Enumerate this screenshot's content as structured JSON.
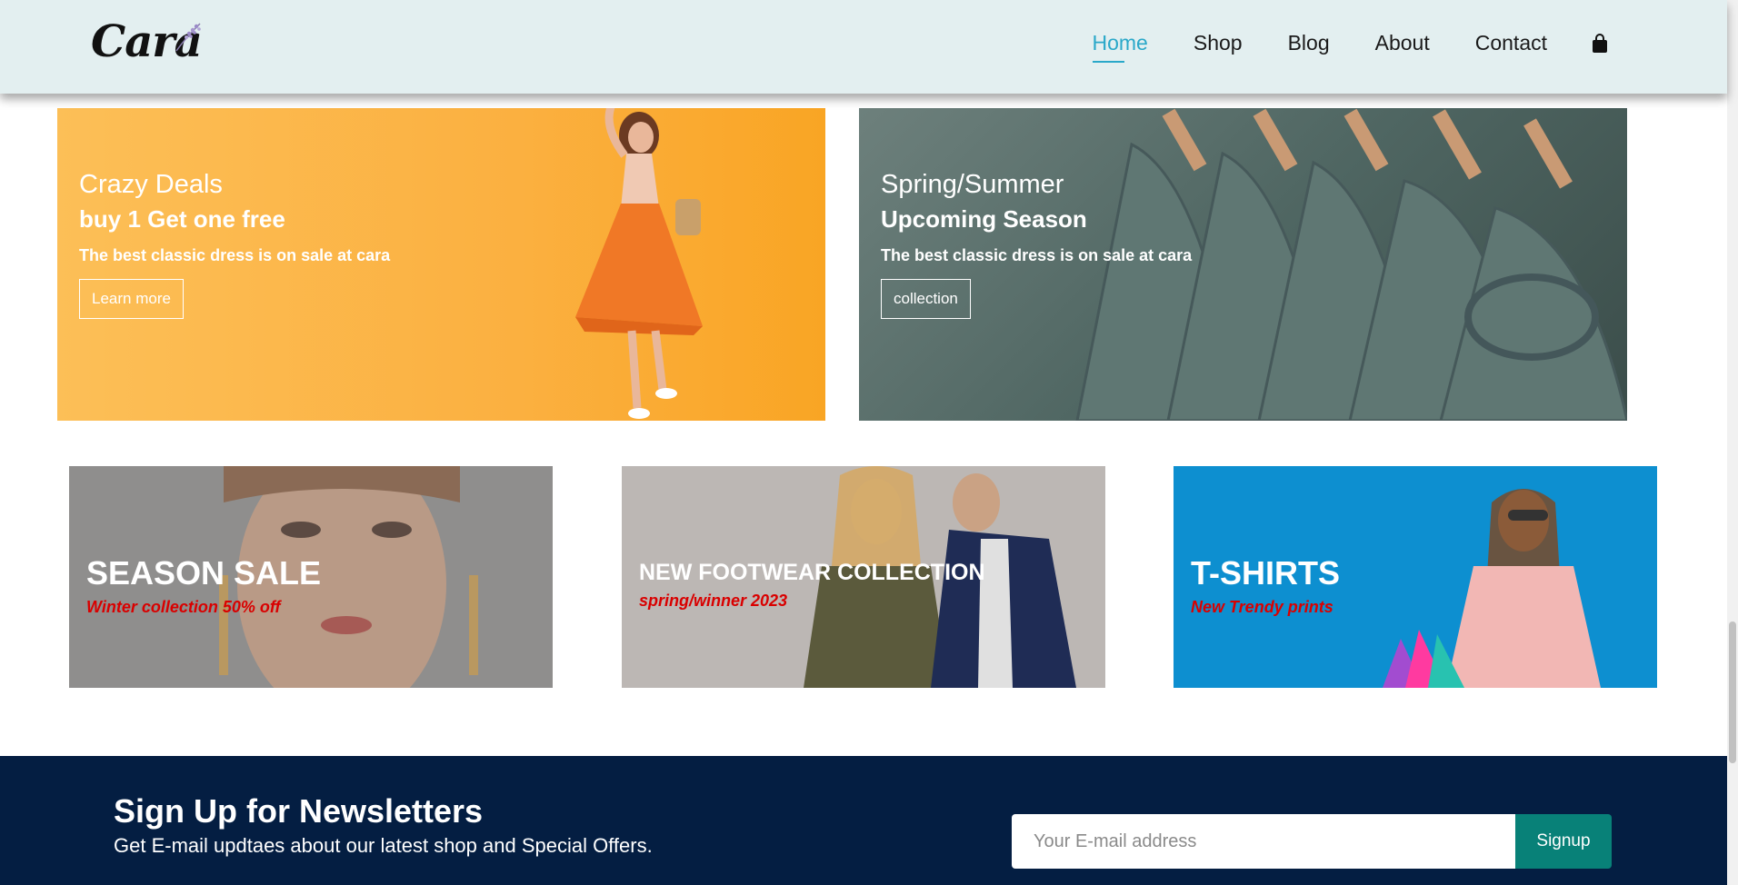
{
  "header": {
    "logo": "Cara",
    "nav": [
      "Home",
      "Shop",
      "Blog",
      "About",
      "Contact"
    ],
    "active": "Home"
  },
  "banners_big": [
    {
      "h4": "Crazy Deals",
      "h2": "buy 1 Get one free",
      "sub": "The best classic dress is on sale at cara",
      "button": "Learn more"
    },
    {
      "h4": "Spring/Summer",
      "h2": "Upcoming Season",
      "sub": "The best classic dress is on sale at cara",
      "button": "collection"
    }
  ],
  "banners_small": [
    {
      "h2": "SEASON SALE",
      "h3": "Winter collection 50% off"
    },
    {
      "h2": "NEW FOOTWEAR COLLECTION",
      "h3": "spring/winner 2023"
    },
    {
      "h2": "T-SHIRTS",
      "h3": "New Trendy prints"
    }
  ],
  "newsletter": {
    "title": "Sign Up for Newsletters",
    "text": "Get E-mail updtaes about our latest shop and Special Offers.",
    "placeholder": "Your E-mail address",
    "button": "Signup"
  },
  "colors": {
    "header_bg": "#e3eff0",
    "accent": "#2aa8c9",
    "newsletter_bg": "#041e42",
    "signup_btn": "#088178",
    "sale_red": "#d90000"
  }
}
